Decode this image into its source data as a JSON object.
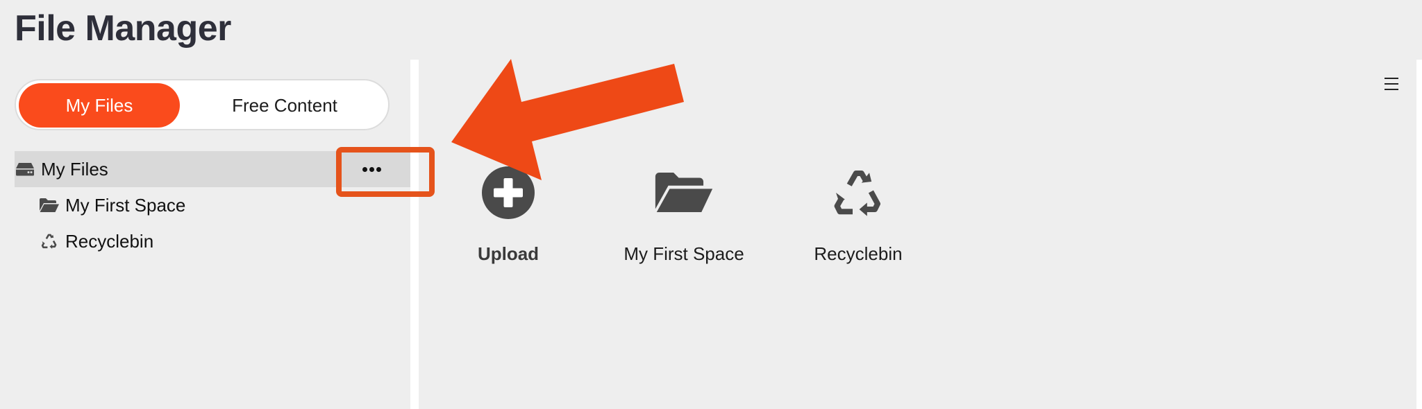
{
  "app": {
    "title": "File Manager"
  },
  "toggle": {
    "my_files": "My Files",
    "free_content": "Free Content"
  },
  "tree": {
    "root": {
      "label": "My Files",
      "icon": "drive-icon"
    },
    "children": [
      {
        "label": "My First Space",
        "icon": "folder-open-icon"
      },
      {
        "label": "Recyclebin",
        "icon": "recycle-icon"
      }
    ]
  },
  "main": {
    "tiles": [
      {
        "label": "Upload",
        "icon": "plus-circle-icon"
      },
      {
        "label": "My First Space",
        "icon": "folder-open-icon"
      },
      {
        "label": "Recyclebin",
        "icon": "recycle-icon"
      }
    ]
  },
  "colors": {
    "accent": "#fa4b1c",
    "annotation": "#e5531b",
    "icon": "#4a4a4a"
  }
}
